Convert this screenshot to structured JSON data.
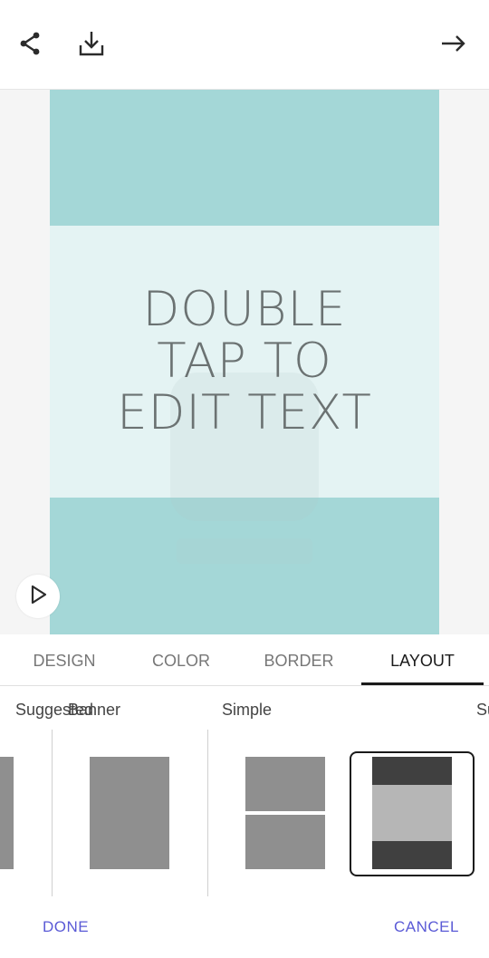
{
  "toolbar": {
    "icons": [
      "share-icon",
      "download-icon",
      "arrow-right-icon"
    ]
  },
  "poster": {
    "text_lines": [
      "DOUBLE",
      "TAP TO",
      "EDIT TEXT"
    ],
    "colors": {
      "band": "#a4d7d7",
      "middle": "#e4f3f3",
      "text": "#6b7272"
    }
  },
  "tabs": [
    {
      "label": "DESIGN"
    },
    {
      "label": "COLOR"
    },
    {
      "label": "BORDER"
    },
    {
      "label": "LAYOUT",
      "active": true
    }
  ],
  "layouts": {
    "categories": [
      {
        "label": "Suggested"
      },
      {
        "label": "Banner"
      },
      {
        "label": "Simple"
      },
      {
        "label": "Su"
      }
    ],
    "selected": "banner-stripe"
  },
  "footer": {
    "done_label": "DONE",
    "cancel_label": "CANCEL",
    "accent": "#5a5ad6"
  }
}
